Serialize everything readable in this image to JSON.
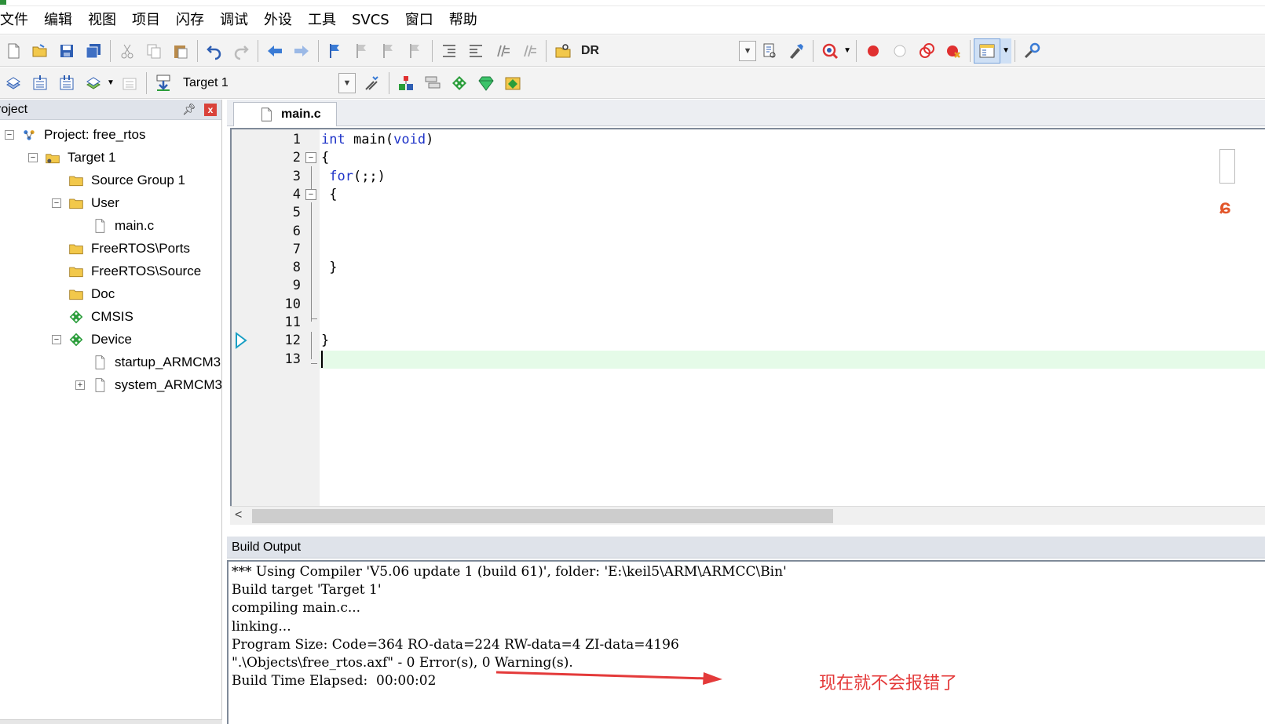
{
  "menubar": {
    "items": [
      "文件",
      "编辑",
      "视图",
      "项目",
      "闪存",
      "调试",
      "外设",
      "工具",
      "SVCS",
      "窗口",
      "帮助"
    ]
  },
  "toolbar1": {
    "dr_label": "DR"
  },
  "toolbar2": {
    "target_value": "Target 1"
  },
  "project_panel": {
    "title": "roject",
    "pin_symbol": "ᵖ",
    "close_symbol": "x",
    "tree": [
      {
        "label": "Project: free_rtos",
        "icon": "project-icon",
        "expander": "−"
      },
      {
        "label": "Target 1",
        "icon": "target-icon",
        "expander": "−"
      },
      {
        "label": "Source Group 1",
        "icon": "folder-icon",
        "expander": ""
      },
      {
        "label": "User",
        "icon": "folder-icon",
        "expander": "−"
      },
      {
        "label": "main.c",
        "icon": "file-icon",
        "expander": ""
      },
      {
        "label": "FreeRTOS\\Ports",
        "icon": "folder-icon",
        "expander": ""
      },
      {
        "label": "FreeRTOS\\Source",
        "icon": "folder-icon",
        "expander": ""
      },
      {
        "label": "Doc",
        "icon": "folder-icon",
        "expander": ""
      },
      {
        "label": "CMSIS",
        "icon": "component-icon",
        "expander": ""
      },
      {
        "label": "Device",
        "icon": "component-icon",
        "expander": "−"
      },
      {
        "label": "startup_ARMCM3",
        "icon": "file-icon",
        "expander": ""
      },
      {
        "label": "system_ARMCM3",
        "icon": "file-icon",
        "expander": "+"
      }
    ]
  },
  "editor": {
    "tab_label": "main.c",
    "line_numbers": [
      "1",
      "2",
      "3",
      "4",
      "5",
      "6",
      "7",
      "8",
      "9",
      "10",
      "11",
      "12",
      "13"
    ],
    "lines": [
      {
        "kw": "int",
        "rest": " main(",
        "kw2": "void",
        "rest2": ")"
      },
      {
        "kw": "",
        "rest": "{",
        "kw2": "",
        "rest2": ""
      },
      {
        "kw": " for",
        "rest": "(;;)",
        "kw2": "",
        "rest2": ""
      },
      {
        "kw": "",
        "rest": " {",
        "kw2": "",
        "rest2": ""
      },
      {
        "kw": "",
        "rest": "",
        "kw2": "",
        "rest2": ""
      },
      {
        "kw": "",
        "rest": "",
        "kw2": "",
        "rest2": ""
      },
      {
        "kw": "",
        "rest": "",
        "kw2": "",
        "rest2": ""
      },
      {
        "kw": "",
        "rest": " }",
        "kw2": "",
        "rest2": ""
      },
      {
        "kw": "",
        "rest": "",
        "kw2": "",
        "rest2": ""
      },
      {
        "kw": "",
        "rest": "",
        "kw2": "",
        "rest2": ""
      },
      {
        "kw": "",
        "rest": "",
        "kw2": "",
        "rest2": ""
      },
      {
        "kw": "",
        "rest": "}",
        "kw2": "",
        "rest2": ""
      },
      {
        "kw": "",
        "rest": "",
        "kw2": "",
        "rest2": ""
      }
    ],
    "scroll_left": "<"
  },
  "build_output": {
    "title": "Build Output",
    "lines": [
      "*** Using Compiler 'V5.06 update 1 (build 61)', folder: 'E:\\keil5\\ARM\\ARMCC\\Bin'",
      "Build target 'Target 1'",
      "compiling main.c...",
      "linking...",
      "Program Size: Code=364 RO-data=224 RW-data=4 ZI-data=4196",
      "\".\\Objects\\free_rtos.axf\" - 0 Error(s), 0 Warning(s).",
      "Build Time Elapsed:  00:00:02"
    ]
  },
  "annotation": {
    "text": "现在就不会报错了",
    "color": "#e43a3a"
  },
  "colors": {
    "keyword": "#1f34c8",
    "current_line": "#e5fbe8",
    "panel_header": "#dfe3ea"
  }
}
